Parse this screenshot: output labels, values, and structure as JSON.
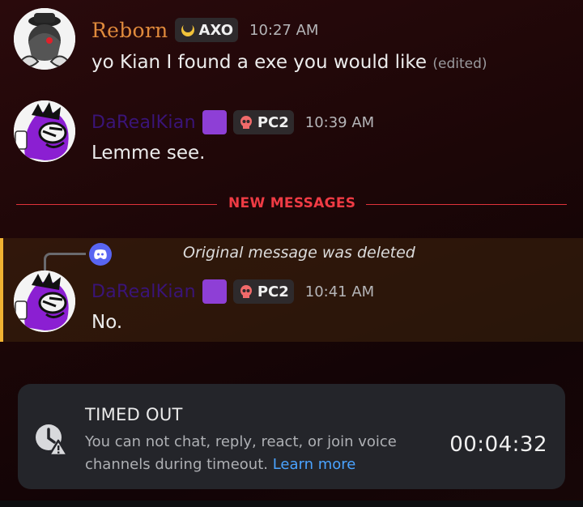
{
  "messages": [
    {
      "author": "Reborn",
      "tag": "AXO",
      "time": "10:27 AM",
      "text": "yo Kian I found a exe you would like",
      "edited": "(edited)"
    },
    {
      "author": "DaRealKian",
      "tag": "PC2",
      "time": "10:39 AM",
      "text": "Lemme see."
    },
    {
      "author": "DaRealKian",
      "tag": "PC2",
      "time": "10:41 AM",
      "text": "No.",
      "reply_text": "Original message was deleted"
    }
  ],
  "divider": {
    "label": "NEW MESSAGES"
  },
  "timeout": {
    "title": "TIMED OUT",
    "description": "You can not chat, reply, react, or join voice channels during timeout.",
    "link": "Learn more",
    "timer": "00:04:32"
  },
  "colors": {
    "reborn_name": "#e08a3c",
    "kian_name": "#3a1478",
    "new_messages": "#ef3b44",
    "link": "#4aa3ff",
    "highlight_bar": "#f0b232",
    "blurple": "#5865f2"
  },
  "icons": {
    "axo_tag": "crescent-icon",
    "pc2_tag": "skull-icon",
    "reply": "discord-icon",
    "timeout": "clock-warning-icon"
  }
}
